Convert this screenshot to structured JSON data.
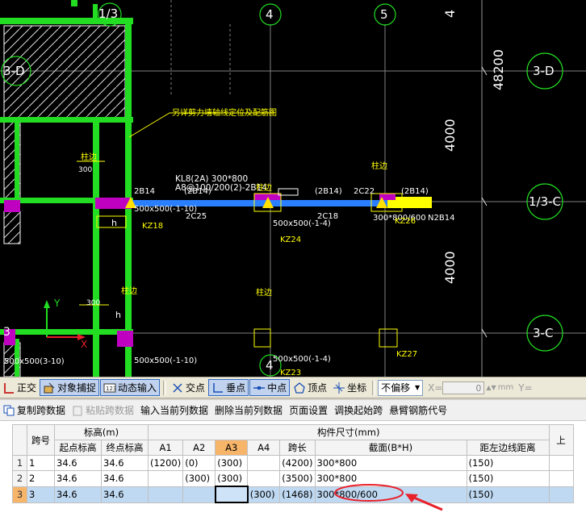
{
  "canvas": {
    "axis_labels": [
      "1/3",
      "4",
      "5",
      "4",
      "4",
      "3-D",
      "3-D",
      "1/3-C",
      "3-C",
      "3"
    ],
    "dims": {
      "top": "4",
      "right_total": "48200",
      "mid1": "4000",
      "mid2": "4000"
    },
    "note": "另详剪力墙轴线定位及配筋图",
    "beam_label1": "KL8(2A) 300*800",
    "beam_label2": "A8@100/200(2)-2B14",
    "texts": {
      "zhubian": "柱边",
      "n300": "300",
      "b2b14": "2B14",
      "b2b14p": "(2B14)",
      "b2c22": "2C22",
      "b2c25": "2C25",
      "b2c18": "2C18",
      "kz18": "KZ18",
      "kz24": "KZ24",
      "kz23": "KZ23",
      "kz26": "KZ26",
      "kz27": "KZ27",
      "col500a": "500x500(-1-10)",
      "col500b": "500x500(-1-4)",
      "col500c": "500x500(-1-10)",
      "col500d": "500x500(-1-4)",
      "col500e": "500x500(3-10)",
      "h": "h",
      "n2b14b": "N2B14",
      "sect": "300*800/600",
      "axisY": "Y",
      "axisX": "X",
      "b2b14r": "(2B14)",
      "zhubian2": "柱边"
    }
  },
  "snapbar": {
    "ortho": "正交",
    "osnap": "对象捕捉",
    "dyn": "动态输入",
    "inter": "交点",
    "perp": "垂点",
    "mid": "中点",
    "vertex": "顶点",
    "coord": "坐标",
    "offset": "不偏移",
    "xlabel": "X=",
    "xval": "0",
    "unit": "mm",
    "ylabel": "Y="
  },
  "toolbar": {
    "copy": "复制跨数据",
    "paste": "粘贴跨数据",
    "input_col": "输入当前列数据",
    "del_col": "删除当前列数据",
    "page": "页面设置",
    "swap": "调换起始跨",
    "hang": "悬臂钢筋代号"
  },
  "grid": {
    "group_headers": {
      "elev": "标高(m)",
      "size": "构件尺寸(mm)",
      "up": "上"
    },
    "headers": [
      "跨号",
      "起点标高",
      "终点标高",
      "A1",
      "A2",
      "A3",
      "A4",
      "跨长",
      "截面(B*H)",
      "距左边线距离"
    ],
    "rows": [
      {
        "num": "1",
        "span": "1",
        "start": "34.6",
        "end": "34.6",
        "a1": "(1200)",
        "a2": "(0)",
        "a3": "(300)",
        "a4": "",
        "len": "(4200)",
        "sect": "300*800",
        "dist": "(150)"
      },
      {
        "num": "2",
        "span": "2",
        "start": "34.6",
        "end": "34.6",
        "a1": "",
        "a2": "(300)",
        "a3": "(300)",
        "a4": "",
        "len": "(3500)",
        "sect": "300*800",
        "dist": "(150)"
      },
      {
        "num": "3",
        "span": "3",
        "start": "34.6",
        "end": "34.6",
        "a1": "",
        "a2": "",
        "a3": "",
        "a4": "(300)",
        "len": "(1468)",
        "sect": "300*800/600",
        "dist": "(150)"
      }
    ]
  },
  "colors": {
    "green": "#22dd22",
    "blue": "#2a7fff",
    "yellow": "#ffff00",
    "magenta": "#c000c0",
    "highlight_red": "#e8202a"
  }
}
